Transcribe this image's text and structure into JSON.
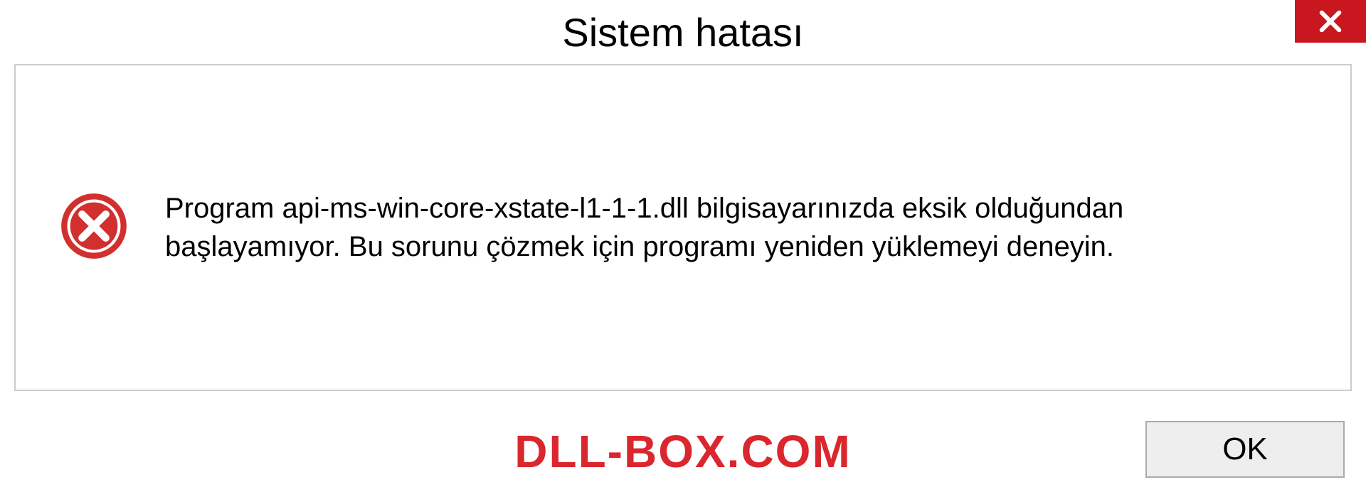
{
  "titlebar": {
    "title": "Sistem hatası",
    "close_icon": "close"
  },
  "dialog": {
    "error_icon": "error-circle",
    "message": "Program api-ms-win-core-xstate-l1-1-1.dll bilgisayarınızda eksik olduğundan başlayamıyor. Bu sorunu çözmek için programı yeniden yüklemeyi deneyin."
  },
  "footer": {
    "watermark": "DLL-BOX.COM",
    "ok_label": "OK"
  },
  "colors": {
    "close_bg": "#c8171e",
    "watermark": "#da272e",
    "border": "#cccccc"
  }
}
